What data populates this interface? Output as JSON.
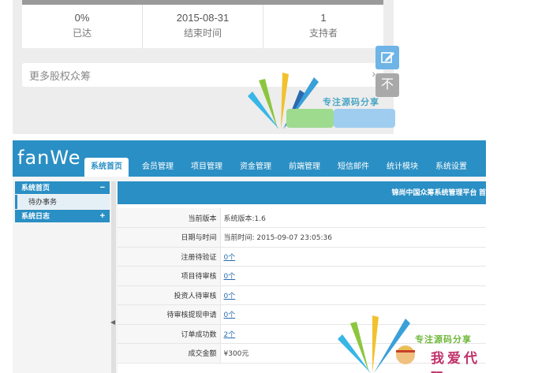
{
  "mobile": {
    "stats": [
      {
        "value": "0%",
        "label": "已达"
      },
      {
        "value": "2015-08-31",
        "label": "结束时间"
      },
      {
        "value": "1",
        "label": "支持者"
      }
    ],
    "more_label": "更多股权众筹",
    "top_button_label": "不",
    "watermark_text": "专注源码分享"
  },
  "admin": {
    "logo": "fanWe",
    "nav": [
      "系统首页",
      "会员管理",
      "项目管理",
      "资金管理",
      "前端管理",
      "短信邮件",
      "统计模块",
      "系统设置"
    ],
    "sidebar": {
      "group1": {
        "label": "系统首页",
        "toggle": "−"
      },
      "group1_items": [
        "待办事务"
      ],
      "group2": {
        "label": "系统日志",
        "toggle": "+"
      }
    },
    "content_title": "锦尚中国众筹系统管理平台 首",
    "rows": [
      {
        "label": "当前版本",
        "value": "系统版本:1.6"
      },
      {
        "label": "日期与时间",
        "value": "当前时间: 2015-09-07 23:05:36"
      },
      {
        "label": "注册待验证",
        "value": "0个"
      },
      {
        "label": "项目待审核",
        "value": "0个"
      },
      {
        "label": "投资人待审核",
        "value": "0个"
      },
      {
        "label": "待审核提现申请",
        "value": "0个"
      },
      {
        "label": "订单成功数",
        "value": "2个"
      },
      {
        "label": "成交金额",
        "value": "¥300元"
      }
    ],
    "watermark_text_1": "专注源码分享",
    "watermark_text_2": "我爱代码"
  },
  "colors": {
    "accent": "#2a8fc4",
    "edit_button": "#6eb4e6"
  }
}
